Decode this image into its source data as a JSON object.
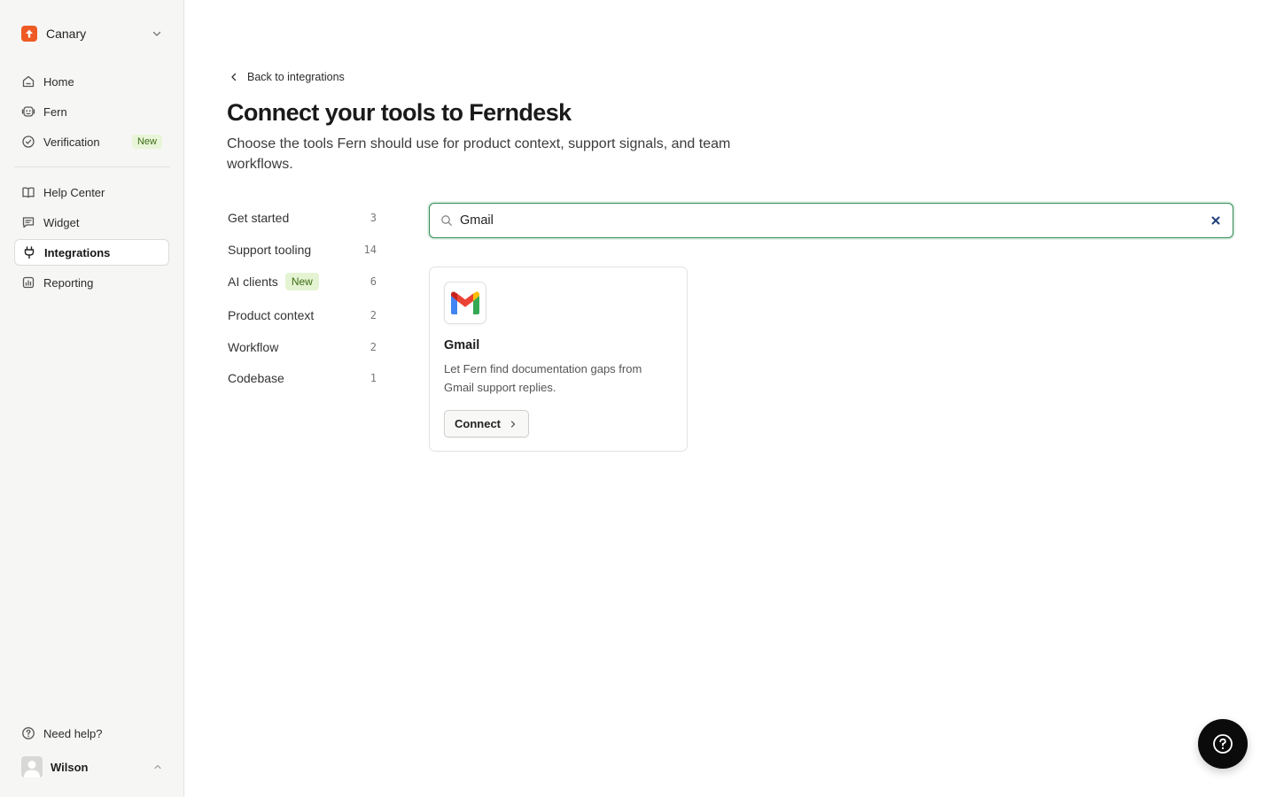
{
  "workspace": {
    "name": "Canary"
  },
  "sidebar": {
    "primary": [
      {
        "label": "Home",
        "icon": "home-icon"
      },
      {
        "label": "Fern",
        "icon": "fern-icon"
      },
      {
        "label": "Verification",
        "icon": "check-circle-icon",
        "badge": "New"
      }
    ],
    "secondary": [
      {
        "label": "Help Center",
        "icon": "book-icon"
      },
      {
        "label": "Widget",
        "icon": "message-icon"
      },
      {
        "label": "Integrations",
        "icon": "plug-icon",
        "active": true
      },
      {
        "label": "Reporting",
        "icon": "chart-icon"
      }
    ],
    "help_label": "Need help?",
    "user_name": "Wilson"
  },
  "main": {
    "back_label": "Back to integrations",
    "title": "Connect your tools to Ferndesk",
    "subtitle": "Choose the tools Fern should use for product context, support signals, and team workflows.",
    "categories": [
      {
        "label": "Get started",
        "count": "3"
      },
      {
        "label": "Support tooling",
        "count": "14"
      },
      {
        "label": "AI clients",
        "count": "6",
        "badge": "New"
      },
      {
        "label": "Product context",
        "count": "2"
      },
      {
        "label": "Workflow",
        "count": "2"
      },
      {
        "label": "Codebase",
        "count": "1"
      }
    ],
    "search": {
      "value": "Gmail"
    },
    "results": [
      {
        "name": "Gmail",
        "description": "Let Fern find documentation gaps from Gmail support replies.",
        "action_label": "Connect",
        "icon": "gmail-icon"
      }
    ]
  },
  "colors": {
    "accent": "#2f8a52",
    "brand": "#ee5a24",
    "badge_bg": "#e4f4d2",
    "badge_text": "#3d6b14"
  }
}
